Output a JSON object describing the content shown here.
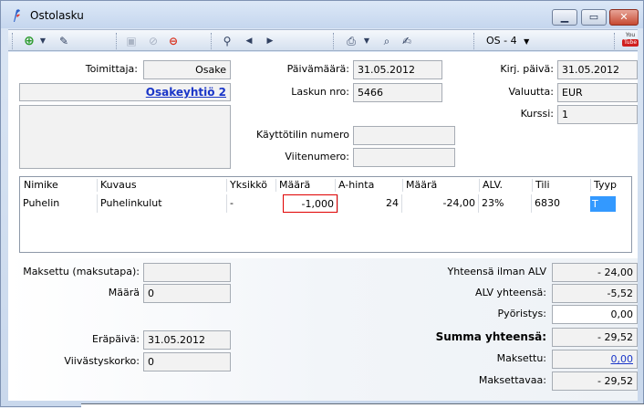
{
  "window": {
    "title": "Ostolasku"
  },
  "toolbar": {
    "layout_label": "OS - 4",
    "youtube_top": "You",
    "youtube_bottom": "Tube"
  },
  "header": {
    "toimittaja_label": "Toimittaja:",
    "toimittaja_value": "Osake",
    "company_link": "Osakeyhtiö 2",
    "paivamaara_label": "Päivämäärä:",
    "paivamaara_value": "31.05.2012",
    "laskun_nro_label": "Laskun nro:",
    "laskun_nro_value": "5466",
    "kirj_paiva_label": "Kirj. päivä:",
    "kirj_paiva_value": "31.05.2012",
    "valuutta_label": "Valuutta:",
    "valuutta_value": "EUR",
    "kurssi_label": "Kurssi:",
    "kurssi_value": "1",
    "kayttotili_label": "Käyttötilin numero",
    "kayttotili_value": "",
    "viitenumero_label": "Viitenumero:",
    "viitenumero_value": ""
  },
  "grid": {
    "columns": [
      "Nimike",
      "Kuvaus",
      "Yksikkö",
      "Määrä",
      "A-hinta",
      "Määrä",
      "ALV.",
      "Tili",
      "Tyyp"
    ],
    "rows": [
      {
        "nimike": "Puhelin",
        "kuvaus": "Puhelinkulut",
        "yksikko": "-",
        "maara": "-1,000",
        "a_hinta": "24",
        "summa": "-24,00",
        "alv": "23%",
        "tili": "6830",
        "tyyp": "T"
      }
    ]
  },
  "footer": {
    "maksettu_maksutapa_label": "Maksettu (maksutapa):",
    "maksettu_maksutapa_value": "",
    "maara_label": "Määrä",
    "maara_value": "0",
    "erapaiva_label": "Eräpäivä:",
    "erapaiva_value": "31.05.2012",
    "viivastyskorko_label": "Viivästyskorko:",
    "viivastyskorko_value": "0",
    "yhteensa_ilman_alv_label": "Yhteensä ilman ALV",
    "yhteensa_ilman_alv_value": "- 24,00",
    "alv_yhteensa_label": "ALV yhteensä:",
    "alv_yhteensa_value": "-5,52",
    "pyoristys_label": "Pyöristys:",
    "pyoristys_value": "0,00",
    "summa_yhteensa_label": "Summa yhteensä:",
    "summa_yhteensa_value": "- 29,52",
    "maksettu_label": "Maksettu:",
    "maksettu_value": "0,00",
    "maksettavaa_label": "Maksettavaa:",
    "maksettavaa_value": "- 29,52"
  }
}
